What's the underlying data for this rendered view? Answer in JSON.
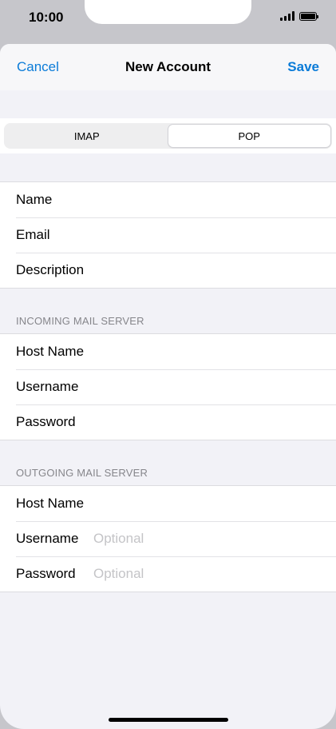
{
  "status_bar": {
    "time": "10:00",
    "signal_icon": "signal-bars-icon",
    "battery_icon": "battery-icon",
    "battery_level": 1.0
  },
  "nav": {
    "cancel_label": "Cancel",
    "title": "New Account",
    "save_label": "Save",
    "accent_color": "#0a7bd8"
  },
  "segmented_control": {
    "options": [
      "IMAP",
      "POP"
    ],
    "selected": "POP"
  },
  "account_fields": [
    {
      "label": "Name",
      "placeholder": ""
    },
    {
      "label": "Email",
      "placeholder": ""
    },
    {
      "label": "Description",
      "placeholder": ""
    }
  ],
  "incoming": {
    "header": "INCOMING MAIL SERVER",
    "fields": [
      {
        "label": "Host Name",
        "placeholder": ""
      },
      {
        "label": "Username",
        "placeholder": ""
      },
      {
        "label": "Password",
        "placeholder": ""
      }
    ]
  },
  "outgoing": {
    "header": "OUTGOING MAIL SERVER",
    "fields": [
      {
        "label": "Host Name",
        "placeholder": ""
      },
      {
        "label": "Username",
        "placeholder": "Optional"
      },
      {
        "label": "Password",
        "placeholder": "Optional"
      }
    ]
  }
}
